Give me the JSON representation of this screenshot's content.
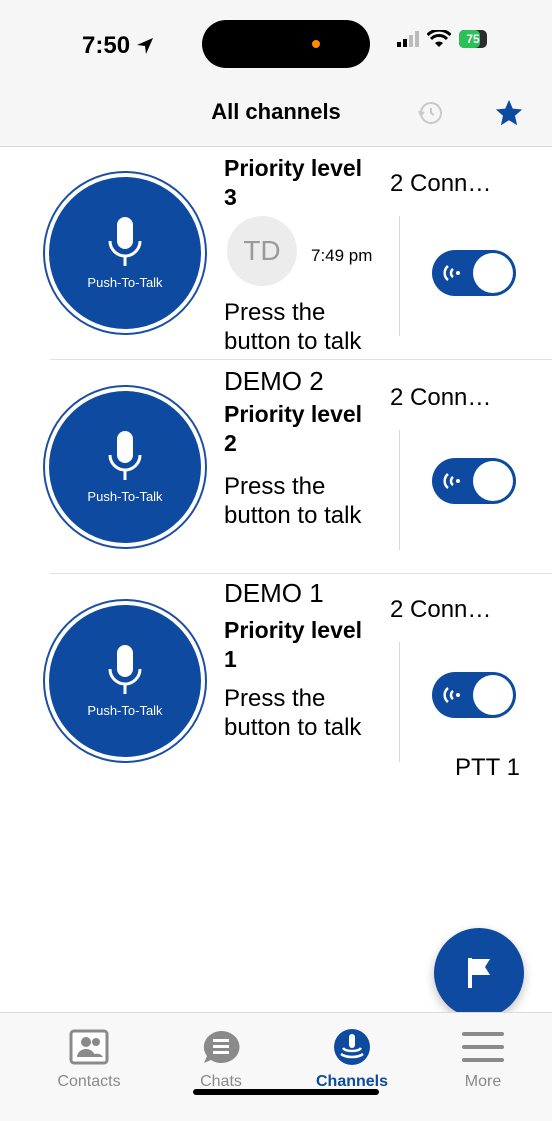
{
  "status_bar": {
    "time": "7:50",
    "battery": "75",
    "battery_level": 0.75
  },
  "header": {
    "title": "All channels"
  },
  "channels": [
    {
      "name": "",
      "priority": "Priority level 3",
      "status": "Press the button to talk",
      "connections": "2 Conn…",
      "ptt_label": "Push-To-Talk",
      "enabled": true,
      "last_message": {
        "avatar_initials": "TD",
        "time": "7:49 pm"
      }
    },
    {
      "name": "DEMO 2",
      "priority": "Priority level 2",
      "status": "Press the button to talk",
      "connections": "2 Conn…",
      "ptt_label": "Push-To-Talk",
      "enabled": true
    },
    {
      "name": "DEMO 1",
      "priority": "Priority level 1",
      "status": "Press the button to talk",
      "connections": "2 Conn…",
      "ptt_label": "Push-To-Talk",
      "enabled": true
    }
  ],
  "ptt_device_name": "PTT 1",
  "tabs": [
    {
      "label": "Contacts",
      "icon": "contacts-icon",
      "active": false
    },
    {
      "label": "Chats",
      "icon": "chats-icon",
      "active": false
    },
    {
      "label": "Channels",
      "icon": "channels-icon",
      "active": true
    },
    {
      "label": "More",
      "icon": "menu-icon",
      "active": false
    }
  ],
  "colors": {
    "accent": "#0d4aa0",
    "inactive": "#8a8a8a"
  }
}
